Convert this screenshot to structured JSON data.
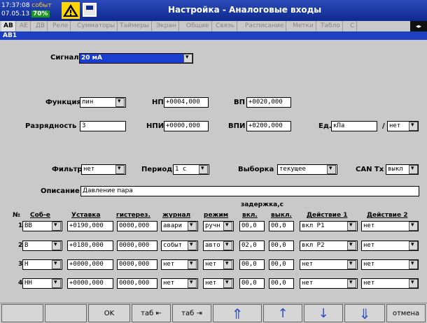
{
  "header": {
    "time": "17:37:08",
    "date": "07.05.13",
    "status": "событ",
    "battery": "70%",
    "title": "Настройка - Аналоговые входы",
    "icons": [
      "warning-icon",
      "save-icon"
    ]
  },
  "tabs": [
    "АВ",
    "АЕ",
    "ДВ",
    "Реле",
    "Сумматоры",
    "Таймеры",
    "Экран",
    "Общие",
    "Связь",
    "Расписание",
    "Метки",
    "Табло",
    "С"
  ],
  "subtitle": "АВ1",
  "form": {
    "signal_label": "Сигнал",
    "signal_value": "20 мА",
    "function_label": "Функция",
    "function_value": "лин",
    "np_label": "НП",
    "np_value": "+0004,000",
    "vp_label": "ВП",
    "vp_value": "+0020,000",
    "digits_label": "Разрядность",
    "digits_value": "3",
    "npi_label": "НПИ",
    "npi_value": "+0000,000",
    "vpi_label": "ВПИ",
    "vpi_value": "+0200,000",
    "unit_label": "Ед.",
    "unit_value": "кПа",
    "unit2_sep": "/",
    "unit2_value": "нет",
    "filter_label": "Фильтр",
    "filter_value": "нет",
    "period_label": "Период",
    "period_value": "1 с",
    "sample_label": "Выборка",
    "sample_value": "текущее",
    "cantx_label": "CAN Tx",
    "cantx_value": "выкл",
    "desc_label": "Описание",
    "desc_value": "Давление пара"
  },
  "table": {
    "headers": {
      "num": "№",
      "event": "Соб-е",
      "setpoint": "Уставка",
      "hyst": "гистерез.",
      "journal": "журнал",
      "mode": "режим",
      "delay": "задержка,с",
      "on": "вкл.",
      "off": "выкл.",
      "act1": "Действие 1",
      "act2": "Действие 2"
    },
    "rows": [
      {
        "n": "1",
        "event": "ВВ",
        "setpoint": "+0190,000",
        "hyst": "0000,000",
        "journal": "авари",
        "mode": "ручн",
        "on": "00,0",
        "off": "00,0",
        "act1": "вкл Р1",
        "act2": "нет"
      },
      {
        "n": "2",
        "event": "В",
        "setpoint": "+0180,000",
        "hyst": "0000,000",
        "journal": "событ",
        "mode": "авто",
        "on": "02,0",
        "off": "00,0",
        "act1": "вкл Р2",
        "act2": "нет"
      },
      {
        "n": "3",
        "event": "Н",
        "setpoint": "+0000,000",
        "hyst": "0000,000",
        "journal": "нет",
        "mode": "нет",
        "on": "00,0",
        "off": "00,0",
        "act1": "нет",
        "act2": "нет"
      },
      {
        "n": "4",
        "event": "НН",
        "setpoint": "+0000,000",
        "hyst": "0000,000",
        "journal": "нет",
        "mode": "нет",
        "on": "00,0",
        "off": "00,0",
        "act1": "нет",
        "act2": "нет"
      }
    ]
  },
  "bottom": {
    "ok": "OK",
    "tab_back": "таб ⇤",
    "tab_fwd": "таб ⇥",
    "page_up": "⇑",
    "up": "↑",
    "down": "↓",
    "page_down": "⇓",
    "cancel": "отмена"
  }
}
